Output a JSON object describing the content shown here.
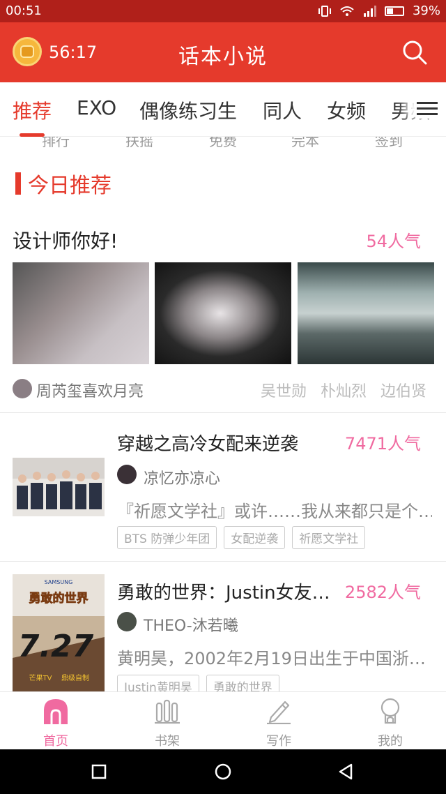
{
  "status_bar": {
    "time": "00:51",
    "battery": "39%"
  },
  "header": {
    "timer": "56:17",
    "title": "话本小说"
  },
  "tabs": [
    "推荐",
    "EXO",
    "偶像练习生",
    "同人",
    "女频",
    "男频"
  ],
  "quick_links": [
    "排行",
    "扶摇",
    "免费",
    "完本",
    "签到"
  ],
  "section": {
    "title": "今日推荐"
  },
  "featured": {
    "title": "设计师你好!",
    "popularity": "54人气",
    "author": "周芮玺喜欢月亮",
    "tags": [
      "吴世勋",
      "朴灿烈",
      "边伯贤"
    ]
  },
  "books": [
    {
      "title": "穿越之高冷女配来逆袭",
      "popularity": "7471人气",
      "author": "凉忆亦凉心",
      "description": "『祈愿文学社』或许……我从来都只是个…",
      "tags": [
        "BTS 防弹少年团",
        "女配逆袭",
        "祈愿文学社"
      ]
    },
    {
      "title": "勇敢的世界：Justin女友…",
      "popularity": "2582人气",
      "author": "THEO-沐若曦",
      "description": "黄明昊，2002年2月19日出生于中国浙…",
      "tags": [
        "Justin黄明昊",
        "勇敢的世界"
      ],
      "cover_text": [
        "SAMSUNG",
        "勇敢的世界",
        "7.27",
        "芒果TV",
        "鼎级自制"
      ]
    }
  ],
  "bottom_nav": [
    "首页",
    "书架",
    "写作",
    "我的"
  ],
  "colors": {
    "primary_red": "#e53a2c",
    "status_red": "#b0201a",
    "pink": "#f06aa0"
  }
}
